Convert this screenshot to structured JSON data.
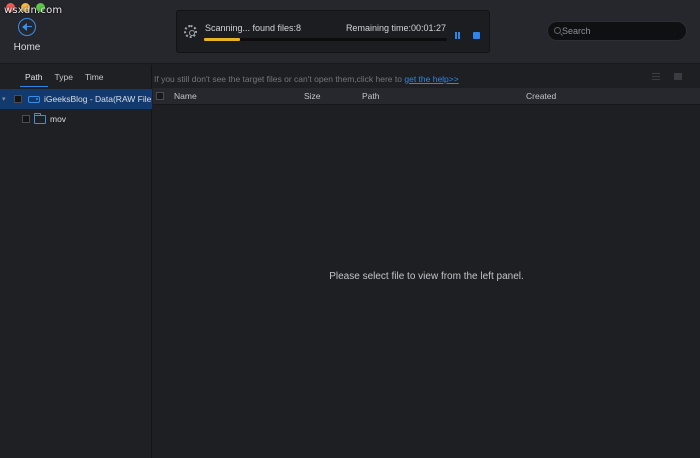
{
  "watermark": "wsxdn.com",
  "header": {
    "home_label": "Home"
  },
  "scan": {
    "status_text": "Scanning... found files:8",
    "remaining_text": "Remaining time:00:01:27",
    "progress_percent": 15,
    "progress_color": "#e8b41f",
    "pause_icon": "pause-icon",
    "stop_icon": "stop-icon"
  },
  "search": {
    "placeholder": "Search",
    "value": ""
  },
  "sidebar": {
    "tabs": [
      {
        "label": "Path",
        "active": true
      },
      {
        "label": "Type",
        "active": false
      },
      {
        "label": "Time",
        "active": false
      }
    ],
    "tree": [
      {
        "label": "iGeeksBlog - Data(RAW File",
        "icon": "drive-icon",
        "selected": true,
        "expanded": true
      },
      {
        "label": "mov",
        "icon": "folder-icon",
        "selected": false
      }
    ]
  },
  "content": {
    "hint_text": "If you still don't see the target files or can't open them,click here to ",
    "hint_link": "get the help>>",
    "columns": [
      "Name",
      "Size",
      "Path",
      "Created"
    ],
    "empty_message": "Please select file to view from the left panel."
  },
  "colors": {
    "accent": "#2f86e8",
    "selection": "#133a6e",
    "background": "#1e1f23"
  }
}
